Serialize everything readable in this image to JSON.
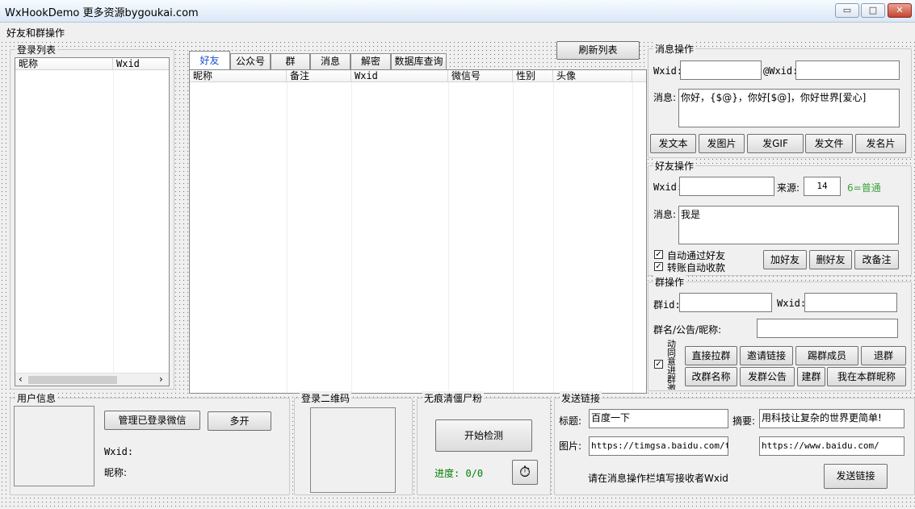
{
  "window": {
    "title": "WxHookDemo 更多资源bygoukai.com",
    "min_glyph": "▭",
    "max_glyph": "□",
    "close_glyph": "✕"
  },
  "menu": {
    "item": "好友和群操作"
  },
  "login_list": {
    "legend": "登录列表",
    "columns": [
      "昵称",
      "Wxid"
    ],
    "scroll_left": "‹",
    "scroll_right": "›"
  },
  "refresh_button": "刷新列表",
  "tabs": [
    "好友",
    "公众号",
    "群",
    "消息",
    "解密",
    "数据库查询"
  ],
  "friend_table": {
    "columns": [
      "昵称",
      "备注",
      "Wxid",
      "微信号",
      "性别",
      "头像"
    ]
  },
  "msg_ops": {
    "legend": "消息操作",
    "wxid_label": "Wxid:",
    "wxid_value": "",
    "at_label": "@Wxid:",
    "at_value": "",
    "msg_label": "消息:",
    "msg_value": "你好，{$@}，你好[$@]，你好世界[爱心]",
    "buttons": [
      "发文本",
      "发图片",
      "发GIF",
      "发文件",
      "发名片"
    ]
  },
  "friend_ops": {
    "legend": "好友操作",
    "wxid_label": "Wxid:",
    "wxid_value": "",
    "source_label": "来源:",
    "source_value": "14",
    "source_hint": "6=普通",
    "msg_label": "消息:",
    "msg_value": "我是",
    "auto_accept": "自动通过好友",
    "auto_collect": "转账自动收款",
    "buttons": [
      "加好友",
      "删好友",
      "改备注"
    ]
  },
  "group_ops": {
    "legend": "群操作",
    "groupid_label": "群id:",
    "groupid_value": "",
    "wxid_label": "Wxid:",
    "wxid_value": "",
    "name_label": "群名/公告/昵称:",
    "name_value": "",
    "auto_label": "动同意进群邀",
    "buttons_row1": [
      "直接拉群",
      "邀请链接",
      "踢群成员",
      "退群"
    ],
    "buttons_row2": [
      "改群名称",
      "发群公告",
      "建群",
      "我在本群昵称"
    ]
  },
  "user_info": {
    "legend": "用户信息",
    "manage_button": "管理已登录微信",
    "multi_button": "多开",
    "wxid_label": "Wxid:",
    "nick_label": "昵称:"
  },
  "qr": {
    "legend": "登录二维码"
  },
  "zombie": {
    "legend": "无痕清僵尸粉",
    "start_button": "开始检测",
    "progress_label": "进度: 0/0",
    "progress_value": 0,
    "timer_icon": "⏱"
  },
  "send_link": {
    "legend": "发送链接",
    "title_label": "标题:",
    "title_value": "百度一下",
    "summary_label": "摘要:",
    "summary_value": "用科技让复杂的世界更简单!",
    "image_label": "图片:",
    "image_value": "https://timgsa.baidu.com/timg",
    "url_value": "https://www.baidu.com/",
    "hint": "请在消息操作栏填写接收者Wxid",
    "send_button": "发送链接"
  },
  "colors": {
    "tab_active": "#1a4fcf",
    "hint_green": "#3aa43a",
    "progress_green": "#008000"
  }
}
